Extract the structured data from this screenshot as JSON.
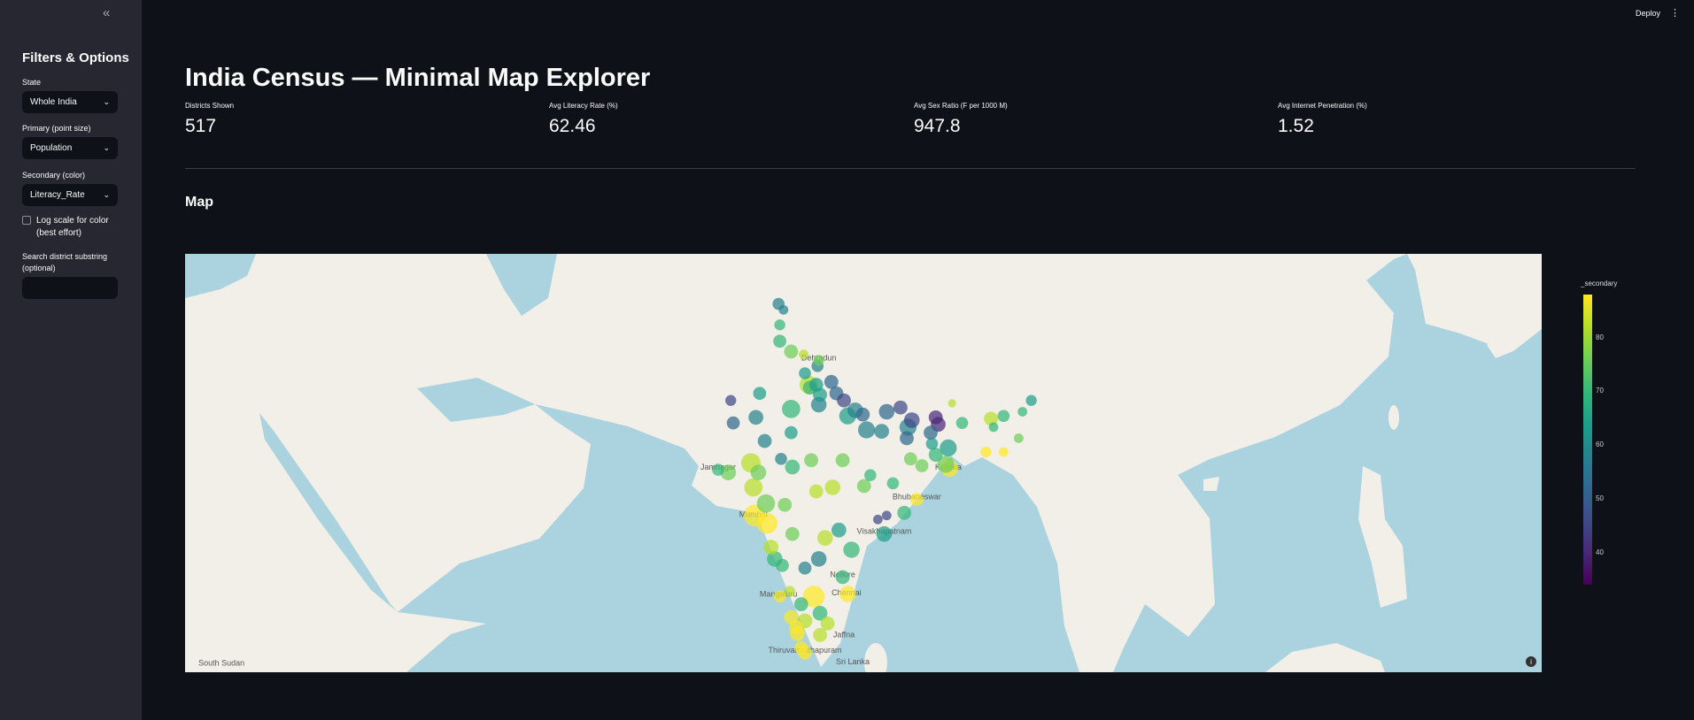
{
  "sidebar": {
    "collapse_icon": "double-chevron-left",
    "title": "Filters & Options",
    "state_label": "State",
    "state_value": "Whole India",
    "primary_label": "Primary (point size)",
    "primary_value": "Population",
    "secondary_label": "Secondary (color)",
    "secondary_value": "Literacy_Rate",
    "log_label": "Log scale for color (best effort)",
    "log_checked": false,
    "search_label": "Search district substring (optional)",
    "search_value": ""
  },
  "header": {
    "deploy": "Deploy",
    "menu_icon": "vertical-ellipsis"
  },
  "main": {
    "title": "India Census — Minimal Map Explorer",
    "metrics": [
      {
        "label": "Districts Shown",
        "value": "517"
      },
      {
        "label": "Avg Literacy Rate (%)",
        "value": "62.46"
      },
      {
        "label": "Avg Sex Ratio (F per 1000 M)",
        "value": "947.8"
      },
      {
        "label": "Avg Internet Penetration (%)",
        "value": "1.52"
      }
    ],
    "map_heading": "Map"
  },
  "chart_data": {
    "type": "scatter",
    "title": "Map",
    "size_field": "Population",
    "color_field": "Literacy_Rate",
    "colorbar": {
      "title": "_secondary",
      "ticks": [
        40,
        50,
        60,
        70,
        80
      ],
      "range": [
        34,
        88
      ],
      "colorscale": "viridis"
    },
    "columns": [
      "lat",
      "lon",
      "literacy",
      "population_millions"
    ],
    "points": [
      [
        34.1,
        74.8,
        60,
        2
      ],
      [
        33.7,
        75.2,
        55,
        1
      ],
      [
        32.7,
        74.9,
        70,
        1.5
      ],
      [
        31.6,
        74.9,
        67,
        2.5
      ],
      [
        30.9,
        75.8,
        75,
        3
      ],
      [
        30.7,
        76.8,
        80,
        1
      ],
      [
        30.3,
        78.0,
        78,
        1.5
      ],
      [
        29.4,
        76.9,
        66,
        2
      ],
      [
        28.6,
        77.2,
        81,
        6
      ],
      [
        28.4,
        77.3,
        70,
        3
      ],
      [
        28.0,
        79.4,
        50,
        3
      ],
      [
        27.2,
        78.0,
        60,
        4
      ],
      [
        26.8,
        80.9,
        55,
        4
      ],
      [
        26.4,
        80.3,
        62,
        5
      ],
      [
        25.4,
        81.8,
        58,
        5
      ],
      [
        25.3,
        83.0,
        60,
        3.5
      ],
      [
        26.7,
        83.4,
        52,
        4
      ],
      [
        27.0,
        84.5,
        45,
        3
      ],
      [
        25.6,
        85.1,
        55,
        5
      ],
      [
        26.1,
        85.4,
        46,
        4
      ],
      [
        25.8,
        87.5,
        40,
        3.5
      ],
      [
        26.3,
        87.3,
        38,
        3
      ],
      [
        24.8,
        85.0,
        52,
        3
      ],
      [
        25.2,
        86.9,
        50,
        3
      ],
      [
        26.5,
        81.5,
        50,
        3
      ],
      [
        27.5,
        80.0,
        48,
        3
      ],
      [
        28.8,
        79.0,
        52,
        3
      ],
      [
        27.9,
        78.1,
        63,
        3
      ],
      [
        26.9,
        75.8,
        72,
        6
      ],
      [
        26.3,
        73.0,
        60,
        3.5
      ],
      [
        28.0,
        73.3,
        62,
        2.5
      ],
      [
        27.5,
        71.0,
        45,
        1.5
      ],
      [
        25.2,
        75.8,
        62,
        2.5
      ],
      [
        24.6,
        73.7,
        58,
        3
      ],
      [
        25.9,
        71.2,
        50,
        2.5
      ],
      [
        23.0,
        72.6,
        80,
        7
      ],
      [
        22.3,
        70.8,
        75,
        4
      ],
      [
        22.5,
        70.0,
        70,
        2
      ],
      [
        21.2,
        72.8,
        80,
        6
      ],
      [
        22.3,
        73.2,
        76,
        4
      ],
      [
        23.3,
        75.0,
        60,
        2
      ],
      [
        22.7,
        75.9,
        72,
        3.5
      ],
      [
        23.2,
        77.4,
        75,
        3
      ],
      [
        23.2,
        79.9,
        73,
        3
      ],
      [
        21.2,
        79.1,
        82,
        4
      ],
      [
        20.9,
        77.8,
        80,
        3
      ],
      [
        19.1,
        72.9,
        88,
        9
      ],
      [
        18.5,
        73.9,
        85,
        8
      ],
      [
        20.0,
        73.8,
        78,
        6
      ],
      [
        19.9,
        75.3,
        75,
        3
      ],
      [
        17.7,
        75.9,
        75,
        3
      ],
      [
        16.7,
        74.2,
        80,
        3.5
      ],
      [
        15.8,
        74.5,
        70,
        4
      ],
      [
        15.3,
        75.1,
        72,
        2.5
      ],
      [
        15.1,
        76.9,
        58,
        2.5
      ],
      [
        17.4,
        78.5,
        82,
        4
      ],
      [
        18.0,
        79.6,
        62,
        3.5
      ],
      [
        16.5,
        80.6,
        70,
        4.5
      ],
      [
        17.7,
        83.2,
        66,
        4
      ],
      [
        15.8,
        78.0,
        60,
        4
      ],
      [
        14.4,
        79.9,
        68,
        3
      ],
      [
        13.1,
        80.3,
        90,
        4.5
      ],
      [
        12.9,
        77.6,
        87,
        9
      ],
      [
        12.3,
        76.6,
        72,
        3
      ],
      [
        13.3,
        75.7,
        80,
        1.5
      ],
      [
        12.9,
        74.9,
        88,
        2
      ],
      [
        11.0,
        76.9,
        84,
        3.5
      ],
      [
        11.6,
        78.1,
        72,
        3.5
      ],
      [
        10.8,
        78.7,
        80,
        3
      ],
      [
        9.9,
        78.1,
        81,
        3
      ],
      [
        10.0,
        76.3,
        95,
        3.5
      ],
      [
        10.5,
        76.2,
        94,
        3
      ],
      [
        11.3,
        75.8,
        95,
        3
      ],
      [
        8.5,
        76.9,
        93,
        3
      ],
      [
        8.9,
        76.6,
        94,
        2.5
      ],
      [
        20.3,
        85.8,
        85,
        2.5
      ],
      [
        19.3,
        84.8,
        72,
        3
      ],
      [
        21.5,
        83.9,
        68,
        2
      ],
      [
        19.1,
        83.4,
        48,
        1
      ],
      [
        18.8,
        82.7,
        45,
        1
      ],
      [
        21.3,
        81.6,
        75,
        3
      ],
      [
        22.1,
        82.1,
        70,
        2
      ],
      [
        22.8,
        86.2,
        75,
        2.5
      ],
      [
        23.3,
        85.3,
        75,
        2.5
      ],
      [
        24.4,
        87.0,
        62,
        2
      ],
      [
        22.6,
        88.4,
        87,
        5
      ],
      [
        22.9,
        88.1,
        78,
        5
      ],
      [
        23.6,
        87.3,
        70,
        3
      ],
      [
        24.1,
        88.3,
        66,
        5
      ],
      [
        25.9,
        89.4,
        68,
        2
      ],
      [
        26.2,
        91.7,
        82,
        3
      ],
      [
        26.4,
        92.7,
        68,
        2
      ],
      [
        27.5,
        94.9,
        62,
        1.5
      ],
      [
        26.7,
        94.2,
        70,
        1
      ],
      [
        23.8,
        92.7,
        88,
        1
      ],
      [
        24.8,
        93.9,
        77,
        1
      ],
      [
        25.6,
        91.9,
        70,
        1
      ],
      [
        23.8,
        91.3,
        85,
        1.5
      ],
      [
        27.3,
        88.6,
        80,
        0.6
      ],
      [
        29.9,
        77.9,
        55,
        2
      ],
      [
        28.6,
        77.8,
        62,
        3
      ]
    ]
  },
  "map": {
    "labels": [
      {
        "text": "Mumbai",
        "lat": 19.0,
        "lon": 72.8
      },
      {
        "text": "Chennai",
        "lat": 13.0,
        "lon": 80.2
      },
      {
        "text": "Kolkata",
        "lat": 22.5,
        "lon": 88.3
      },
      {
        "text": "Nellore",
        "lat": 14.4,
        "lon": 79.9
      },
      {
        "text": "Visakhapatnam",
        "lat": 17.7,
        "lon": 83.2
      },
      {
        "text": "Bhubaneswar",
        "lat": 20.3,
        "lon": 85.8
      },
      {
        "text": "Jamnagar",
        "lat": 22.5,
        "lon": 70.0
      },
      {
        "text": "Mangaluru",
        "lat": 12.9,
        "lon": 74.8
      },
      {
        "text": "Thiruvananthapuram",
        "lat": 8.5,
        "lon": 76.9
      },
      {
        "text": "Jaffna",
        "lat": 9.7,
        "lon": 80.0
      },
      {
        "text": "Sri Lanka",
        "lat": 7.6,
        "lon": 80.7
      },
      {
        "text": "Dehradun",
        "lat": 30.3,
        "lon": 78.0
      },
      {
        "text": "South Sudan",
        "lat": 7.5,
        "lon": 30.5
      }
    ],
    "attribution_icon": "info"
  }
}
